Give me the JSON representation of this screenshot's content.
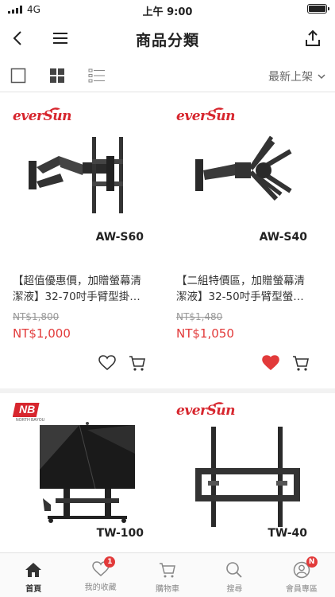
{
  "status_bar": {
    "network": "4G",
    "time": "上午 9:00"
  },
  "header": {
    "title": "商品分類"
  },
  "filter_bar": {
    "sort_label": "最新上架"
  },
  "products": [
    {
      "brand": "everSun",
      "model": "AW-S60",
      "name_line1": "【超值優惠價，加贈螢幕清",
      "name_line2": "潔液】32-70吋手臂型掛…",
      "original_price": "NT$1,800",
      "price": "NT$1,000",
      "favorited": false
    },
    {
      "brand": "everSun",
      "model": "AW-S40",
      "name_line1": "【二組特價區，加贈螢幕清",
      "name_line2": "潔液】32-50吋手臂型螢…",
      "original_price": "NT$1,480",
      "price": "NT$1,050",
      "favorited": true
    },
    {
      "brand": "NB",
      "brand_sub": "NORTH BAYOU",
      "model": "TW-100"
    },
    {
      "brand": "everSun",
      "model": "TW-40"
    }
  ],
  "tab_bar": {
    "tabs": [
      {
        "label": "首頁",
        "active": true
      },
      {
        "label": "我的收藏",
        "badge": "1"
      },
      {
        "label": "購物車"
      },
      {
        "label": "搜尋"
      },
      {
        "label": "會員專區",
        "badge": "N"
      }
    ]
  },
  "colors": {
    "accent_red": "#e23a3a",
    "brand_red": "#d7262e"
  }
}
